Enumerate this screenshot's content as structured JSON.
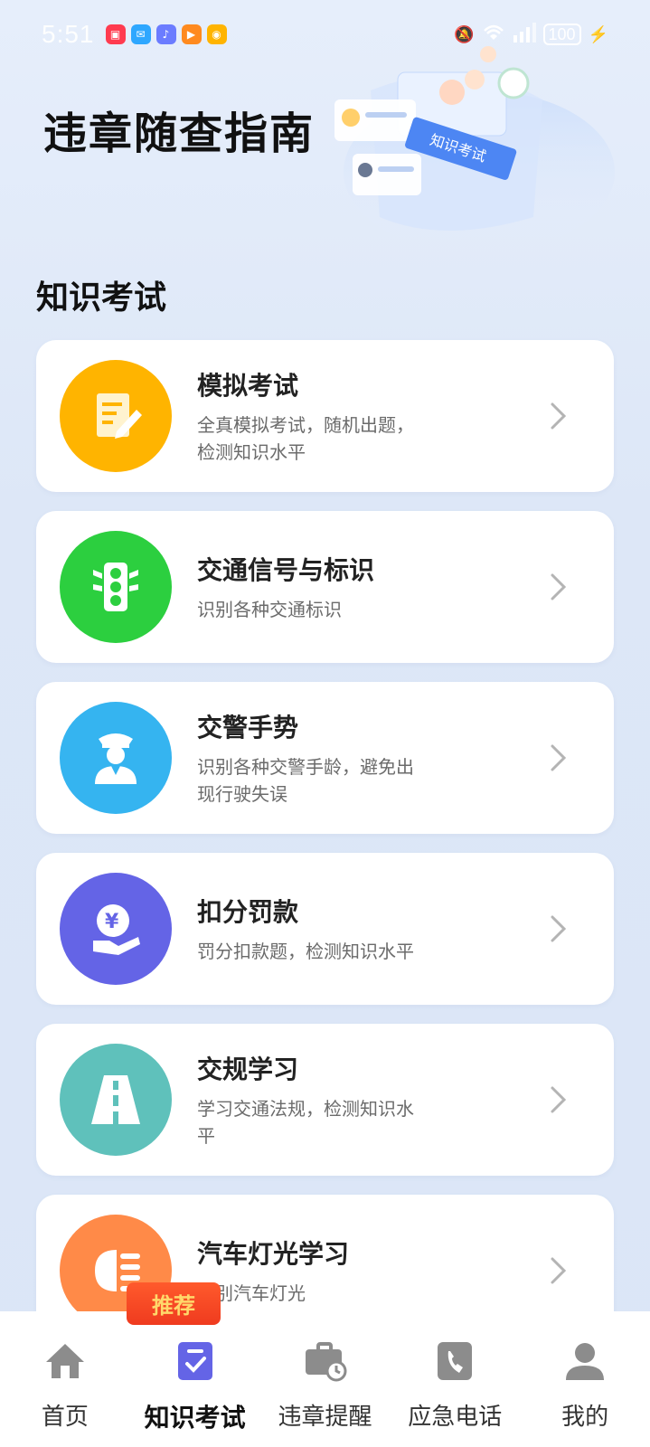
{
  "status_bar": {
    "time": "5:51",
    "battery": "100",
    "apps": [
      {
        "name": "app-red-icon",
        "color": "#ff3b4f"
      },
      {
        "name": "app-chat-icon",
        "color": "#2ea7ff"
      },
      {
        "name": "app-music-icon",
        "color": "#6b7cff"
      },
      {
        "name": "app-video-icon",
        "color": "#ff8a1f"
      },
      {
        "name": "app-weibo-icon",
        "color": "#ffb400"
      }
    ]
  },
  "header": {
    "title": "违章随查指南",
    "illustration_label": "知识考试"
  },
  "section": {
    "title": "知识考试"
  },
  "cards": [
    {
      "title": "模拟考试",
      "desc": "全真模拟考试，随机出题，检测知识水平",
      "color": "#ffb400",
      "icon": "exam-paper-icon"
    },
    {
      "title": "交通信号与标识",
      "desc": "识别各种交通标识",
      "color": "#2ccf3f",
      "icon": "traffic-light-icon"
    },
    {
      "title": "交警手势",
      "desc": "识别各种交警手龄，避免出现行驶失误",
      "color": "#35b4f0",
      "icon": "police-officer-icon"
    },
    {
      "title": "扣分罚款",
      "desc": "罚分扣款题，检测知识水平",
      "color": "#6464e6",
      "icon": "fine-money-icon"
    },
    {
      "title": "交规学习",
      "desc": "学习交通法规，检测知识水平",
      "color": "#5fc1bb",
      "icon": "road-icon"
    },
    {
      "title": "汽车灯光学习",
      "desc": "识别汽车灯光",
      "color": "#ff8a48",
      "icon": "headlight-icon"
    }
  ],
  "badge": {
    "label": "推荐"
  },
  "nav": [
    {
      "label": "首页",
      "icon": "home-icon"
    },
    {
      "label": "知识考试",
      "icon": "exam-icon",
      "active": true
    },
    {
      "label": "违章提醒",
      "icon": "briefcase-clock-icon"
    },
    {
      "label": "应急电话",
      "icon": "phone-icon"
    },
    {
      "label": "我的",
      "icon": "profile-icon"
    }
  ]
}
